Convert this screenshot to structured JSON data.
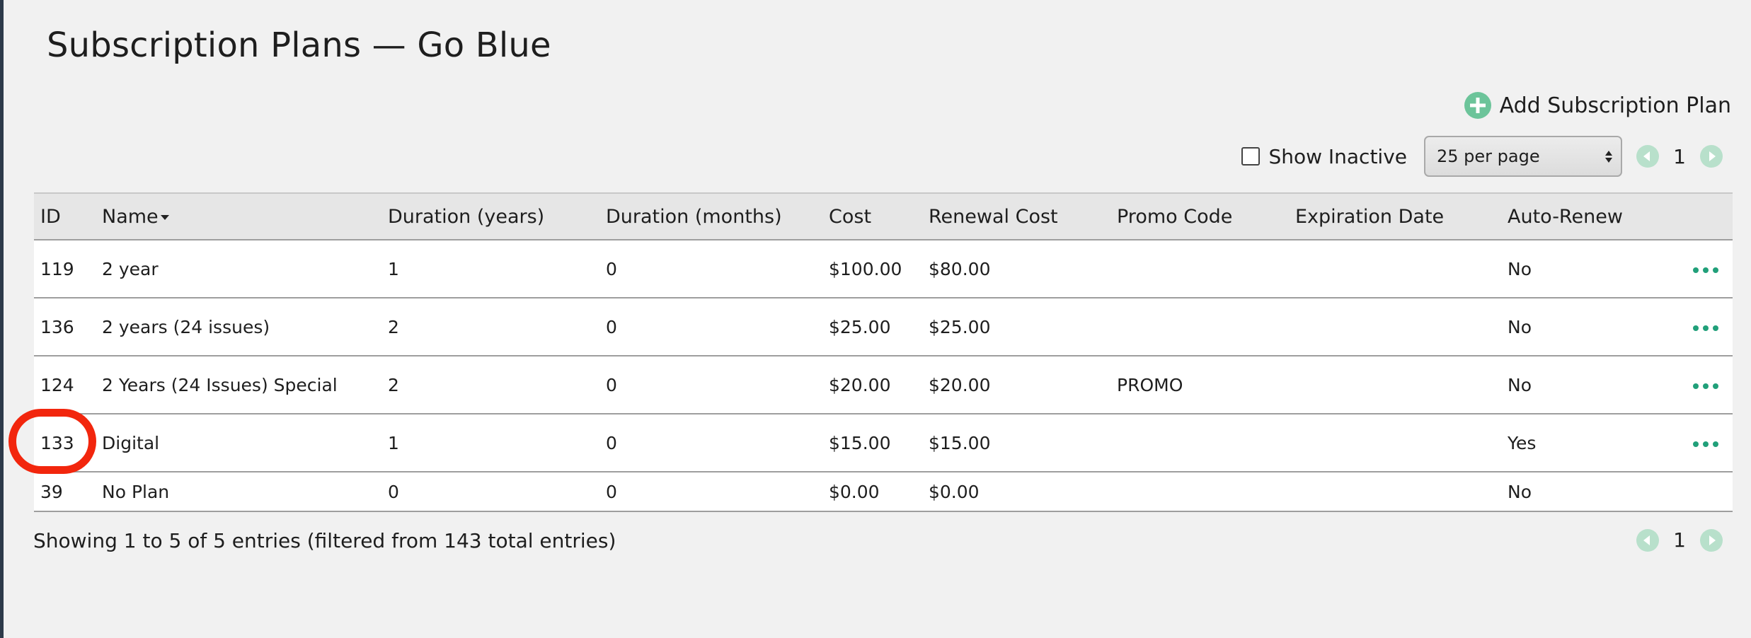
{
  "page": {
    "title": "Subscription Plans — Go Blue"
  },
  "actions": {
    "add_label": "Add Subscription Plan"
  },
  "controls": {
    "show_inactive_label": "Show Inactive",
    "per_page_selected": "25 per page",
    "current_page": "1"
  },
  "table": {
    "columns": [
      "ID",
      "Name",
      "Duration (years)",
      "Duration (months)",
      "Cost",
      "Renewal Cost",
      "Promo Code",
      "Expiration Date",
      "Auto-Renew"
    ],
    "rows": [
      {
        "id": "119",
        "name": "2 year",
        "years": "1",
        "months": "0",
        "cost": "$100.00",
        "renewal": "$80.00",
        "promo": "",
        "expiration": "",
        "auto_renew": "No"
      },
      {
        "id": "136",
        "name": "2 years (24 issues)",
        "years": "2",
        "months": "0",
        "cost": "$25.00",
        "renewal": "$25.00",
        "promo": "",
        "expiration": "",
        "auto_renew": "No"
      },
      {
        "id": "124",
        "name": "2 Years (24 Issues) Special",
        "years": "2",
        "months": "0",
        "cost": "$20.00",
        "renewal": "$20.00",
        "promo": "PROMO",
        "expiration": "",
        "auto_renew": "No"
      },
      {
        "id": "133",
        "name": "Digital",
        "years": "1",
        "months": "0",
        "cost": "$15.00",
        "renewal": "$15.00",
        "promo": "",
        "expiration": "",
        "auto_renew": "Yes"
      },
      {
        "id": "39",
        "name": "No Plan",
        "years": "0",
        "months": "0",
        "cost": "$0.00",
        "renewal": "$0.00",
        "promo": "",
        "expiration": "",
        "auto_renew": "No"
      }
    ]
  },
  "footer": {
    "info": "Showing 1 to 5 of 5 entries (filtered from 143 total entries)",
    "current_page": "1"
  },
  "colors": {
    "accent": "#21a07a",
    "pager": "#b8e0cb",
    "highlight": "#f2260d"
  },
  "icons": {
    "add": "plus-circle-icon",
    "prev": "chevron-left-icon",
    "next": "chevron-right-icon",
    "row_menu": "more-horizontal-icon"
  }
}
